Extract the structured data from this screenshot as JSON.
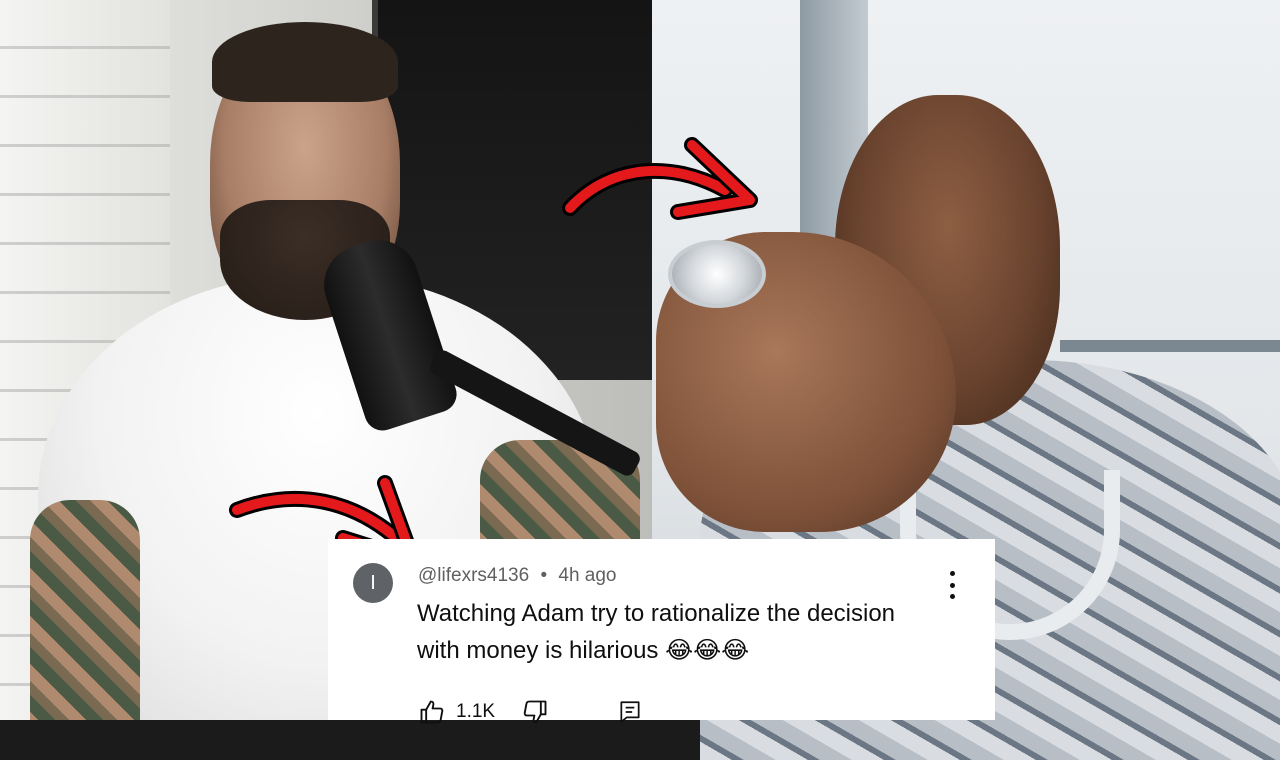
{
  "comment": {
    "avatar_initial": "I",
    "author": "@lifexrs4136",
    "separator": "•",
    "time": "4h ago",
    "text_line1": "Watching Adam try to rationalize the decision",
    "text_line2": "with money is hilarious 😂😂😂",
    "like_count": "1.1K"
  },
  "icons": {
    "like": "thumbs-up-icon",
    "dislike": "thumbs-down-icon",
    "reply": "reply-comment-icon",
    "menu": "more-vert-icon",
    "arrows": "red-curved-arrow-icon"
  },
  "colors": {
    "arrow_red": "#e3191b",
    "arrow_outline": "#000000",
    "meta_text": "#606060",
    "comment_text": "#0f0f0f",
    "avatar_bg": "#5f6368"
  }
}
